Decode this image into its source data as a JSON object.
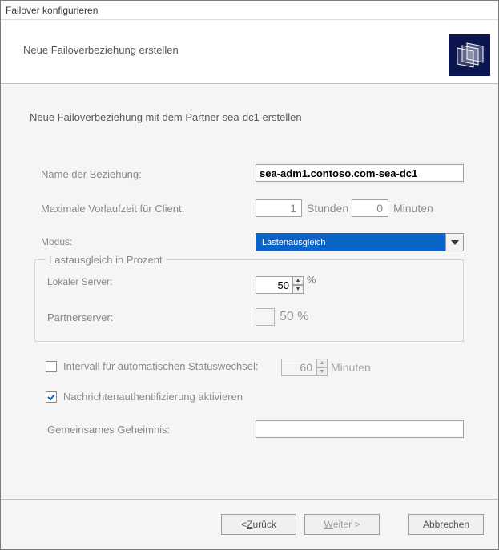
{
  "title": "Failover konfigurieren",
  "header": {
    "subtitle": "Neue Failoverbeziehung erstellen"
  },
  "instruction": "Neue Failoverbeziehung mit dem Partner sea-dc1 erstellen",
  "labels": {
    "relationship_name": "Name der Beziehung:",
    "max_lead_time": "Maximale Vorlaufzeit für Client:",
    "mode": "Modus:",
    "group_title": "Lastausgleich in Prozent",
    "local_server": "Lokaler Server:",
    "partner_server": "Partnerserver:",
    "interval_checkbox": "Intervall für automatischen Statuswechsel:",
    "auth_checkbox": "Nachrichtenauthentifizierung aktivieren",
    "shared_secret": "Gemeinsames Geheimnis:",
    "hours": "Stunden",
    "minutes": "Minuten",
    "percent_sign": "%",
    "partner_percent_display": "50 %",
    "interval_minutes_lbl": "Minuten"
  },
  "values": {
    "relationship_name": "sea-adm1.contoso.com-sea-dc1",
    "lead_hours": "1",
    "lead_minutes": "0",
    "mode_selected": "Lastenausgleich",
    "local_percent": "50",
    "partner_percent": "50",
    "interval_enabled": false,
    "interval_value": "60",
    "auth_enabled": true,
    "shared_secret": ""
  },
  "buttons": {
    "back_prefix": "< ",
    "back_letter": "Z",
    "back_rest": "urück",
    "next_letter": "W",
    "next_rest": "eiter >",
    "cancel": "Abbrechen"
  }
}
